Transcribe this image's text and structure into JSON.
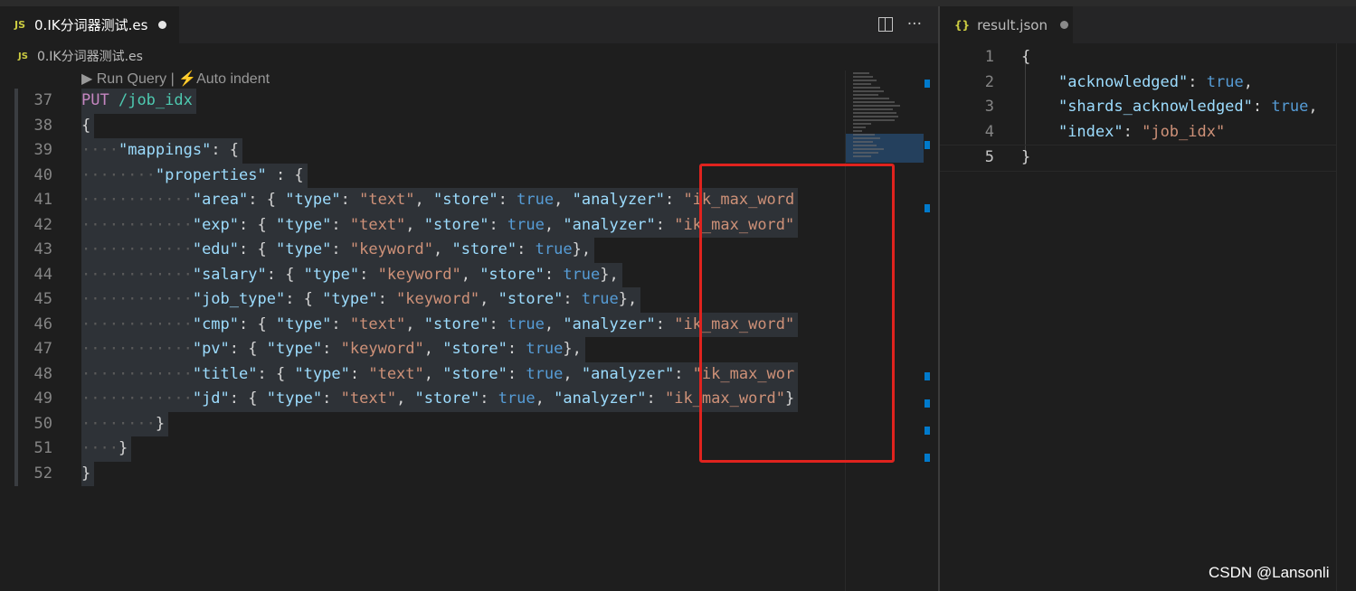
{
  "left_tab": {
    "icon": "JS",
    "label": "0.IK分词器测试.es"
  },
  "breadcrumb": {
    "icon": "JS",
    "label": "0.IK分词器测试.es"
  },
  "tab_actions": {
    "more": "···"
  },
  "codelens": {
    "run": "▶ Run Query",
    "sep": " | ",
    "auto": "⚡Auto indent"
  },
  "editor": {
    "lines": [
      {
        "n": "37"
      },
      {
        "n": "38"
      },
      {
        "n": "39"
      },
      {
        "n": "40"
      },
      {
        "n": "41"
      },
      {
        "n": "42"
      },
      {
        "n": "43"
      },
      {
        "n": "44"
      },
      {
        "n": "45"
      },
      {
        "n": "46"
      },
      {
        "n": "47"
      },
      {
        "n": "48"
      },
      {
        "n": "49"
      },
      {
        "n": "50"
      },
      {
        "n": "51"
      },
      {
        "n": "52"
      }
    ],
    "code": [
      [
        [
          "k-method",
          "PUT"
        ],
        [
          "k-p",
          " "
        ],
        [
          "k-path",
          "/job_idx"
        ]
      ],
      [
        [
          "k-p",
          "{"
        ]
      ],
      [
        [
          "ws",
          "····"
        ],
        [
          "k-key",
          "\"mappings\""
        ],
        [
          "k-p",
          ": {"
        ]
      ],
      [
        [
          "ws",
          "········"
        ],
        [
          "k-key",
          "\"properties\""
        ],
        [
          "k-p",
          " : {"
        ]
      ],
      [
        [
          "ws",
          "············"
        ],
        [
          "k-key",
          "\"area\""
        ],
        [
          "k-p",
          ": { "
        ],
        [
          "k-key",
          "\"type\""
        ],
        [
          "k-p",
          ": "
        ],
        [
          "k-str",
          "\"text\""
        ],
        [
          "k-p",
          ", "
        ],
        [
          "k-key",
          "\"store\""
        ],
        [
          "k-p",
          ": "
        ],
        [
          "k-bool",
          "true"
        ],
        [
          "k-p",
          ", "
        ],
        [
          "k-key",
          "\"analyzer\""
        ],
        [
          "k-p",
          ": "
        ],
        [
          "k-str",
          "\"ik_max_word"
        ]
      ],
      [
        [
          "ws",
          "············"
        ],
        [
          "k-key",
          "\"exp\""
        ],
        [
          "k-p",
          ": { "
        ],
        [
          "k-key",
          "\"type\""
        ],
        [
          "k-p",
          ": "
        ],
        [
          "k-str",
          "\"text\""
        ],
        [
          "k-p",
          ", "
        ],
        [
          "k-key",
          "\"store\""
        ],
        [
          "k-p",
          ": "
        ],
        [
          "k-bool",
          "true"
        ],
        [
          "k-p",
          ", "
        ],
        [
          "k-key",
          "\"analyzer\""
        ],
        [
          "k-p",
          ": "
        ],
        [
          "k-str",
          "\"ik_max_word\""
        ]
      ],
      [
        [
          "ws",
          "············"
        ],
        [
          "k-key",
          "\"edu\""
        ],
        [
          "k-p",
          ": { "
        ],
        [
          "k-key",
          "\"type\""
        ],
        [
          "k-p",
          ": "
        ],
        [
          "k-str",
          "\"keyword\""
        ],
        [
          "k-p",
          ", "
        ],
        [
          "k-key",
          "\"store\""
        ],
        [
          "k-p",
          ": "
        ],
        [
          "k-bool",
          "true"
        ],
        [
          "k-p",
          "},"
        ]
      ],
      [
        [
          "ws",
          "············"
        ],
        [
          "k-key",
          "\"salary\""
        ],
        [
          "k-p",
          ": { "
        ],
        [
          "k-key",
          "\"type\""
        ],
        [
          "k-p",
          ": "
        ],
        [
          "k-str",
          "\"keyword\""
        ],
        [
          "k-p",
          ", "
        ],
        [
          "k-key",
          "\"store\""
        ],
        [
          "k-p",
          ": "
        ],
        [
          "k-bool",
          "true"
        ],
        [
          "k-p",
          "},"
        ]
      ],
      [
        [
          "ws",
          "············"
        ],
        [
          "k-key",
          "\"job_type\""
        ],
        [
          "k-p",
          ": { "
        ],
        [
          "k-key",
          "\"type\""
        ],
        [
          "k-p",
          ": "
        ],
        [
          "k-str",
          "\"keyword\""
        ],
        [
          "k-p",
          ", "
        ],
        [
          "k-key",
          "\"store\""
        ],
        [
          "k-p",
          ": "
        ],
        [
          "k-bool",
          "true"
        ],
        [
          "k-p",
          "},"
        ]
      ],
      [
        [
          "ws",
          "············"
        ],
        [
          "k-key",
          "\"cmp\""
        ],
        [
          "k-p",
          ": { "
        ],
        [
          "k-key",
          "\"type\""
        ],
        [
          "k-p",
          ": "
        ],
        [
          "k-str",
          "\"text\""
        ],
        [
          "k-p",
          ", "
        ],
        [
          "k-key",
          "\"store\""
        ],
        [
          "k-p",
          ": "
        ],
        [
          "k-bool",
          "true"
        ],
        [
          "k-p",
          ", "
        ],
        [
          "k-key",
          "\"analyzer\""
        ],
        [
          "k-p",
          ": "
        ],
        [
          "k-str",
          "\"ik_max_word\""
        ]
      ],
      [
        [
          "ws",
          "············"
        ],
        [
          "k-key",
          "\"pv\""
        ],
        [
          "k-p",
          ": { "
        ],
        [
          "k-key",
          "\"type\""
        ],
        [
          "k-p",
          ": "
        ],
        [
          "k-str",
          "\"keyword\""
        ],
        [
          "k-p",
          ", "
        ],
        [
          "k-key",
          "\"store\""
        ],
        [
          "k-p",
          ": "
        ],
        [
          "k-bool",
          "true"
        ],
        [
          "k-p",
          "},"
        ]
      ],
      [
        [
          "ws",
          "············"
        ],
        [
          "k-key",
          "\"title\""
        ],
        [
          "k-p",
          ": { "
        ],
        [
          "k-key",
          "\"type\""
        ],
        [
          "k-p",
          ": "
        ],
        [
          "k-str",
          "\"text\""
        ],
        [
          "k-p",
          ", "
        ],
        [
          "k-key",
          "\"store\""
        ],
        [
          "k-p",
          ": "
        ],
        [
          "k-bool",
          "true"
        ],
        [
          "k-p",
          ", "
        ],
        [
          "k-key",
          "\"analyzer\""
        ],
        [
          "k-p",
          ": "
        ],
        [
          "k-str",
          "\"ik_max_wor"
        ]
      ],
      [
        [
          "ws",
          "············"
        ],
        [
          "k-key",
          "\"jd\""
        ],
        [
          "k-p",
          ": { "
        ],
        [
          "k-key",
          "\"type\""
        ],
        [
          "k-p",
          ": "
        ],
        [
          "k-str",
          "\"text\""
        ],
        [
          "k-p",
          ", "
        ],
        [
          "k-key",
          "\"store\""
        ],
        [
          "k-p",
          ": "
        ],
        [
          "k-bool",
          "true"
        ],
        [
          "k-p",
          ", "
        ],
        [
          "k-key",
          "\"analyzer\""
        ],
        [
          "k-p",
          ": "
        ],
        [
          "k-str",
          "\"ik_max_word\""
        ],
        [
          "k-p",
          "}"
        ]
      ],
      [
        [
          "ws",
          "········"
        ],
        [
          "k-p",
          "}"
        ]
      ],
      [
        [
          "ws",
          "····"
        ],
        [
          "k-p",
          "}"
        ]
      ],
      [
        [
          "k-p",
          "}"
        ]
      ]
    ]
  },
  "right_tab": {
    "icon": "{}",
    "label": "result.json"
  },
  "result": {
    "lines": [
      {
        "n": "1"
      },
      {
        "n": "2"
      },
      {
        "n": "3"
      },
      {
        "n": "4"
      },
      {
        "n": "5"
      }
    ],
    "code": [
      [
        [
          "k-p",
          "{"
        ]
      ],
      [
        [
          "k-p",
          "    "
        ],
        [
          "k-key",
          "\"acknowledged\""
        ],
        [
          "k-p",
          ": "
        ],
        [
          "k-bool",
          "true"
        ],
        [
          "k-p",
          ","
        ]
      ],
      [
        [
          "k-p",
          "    "
        ],
        [
          "k-key",
          "\"shards_acknowledged\""
        ],
        [
          "k-p",
          ": "
        ],
        [
          "k-bool",
          "true"
        ],
        [
          "k-p",
          ","
        ]
      ],
      [
        [
          "k-p",
          "    "
        ],
        [
          "k-key",
          "\"index\""
        ],
        [
          "k-p",
          ": "
        ],
        [
          "k-str",
          "\"job_idx\""
        ]
      ],
      [
        [
          "k-p",
          "}"
        ]
      ]
    ]
  },
  "watermark": "CSDN @Lansonli",
  "colors": {
    "accent": "#007acc",
    "annotation_box": "#e0231e"
  }
}
